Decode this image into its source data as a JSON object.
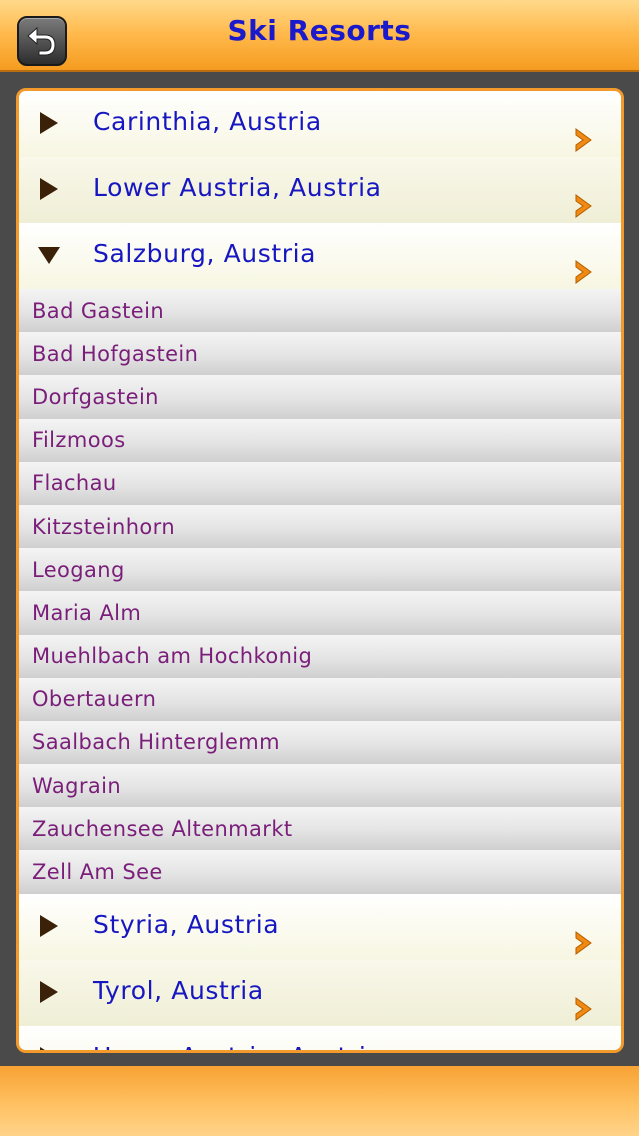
{
  "header": {
    "title": "Ski Resorts",
    "back_icon": "back-arrow-icon"
  },
  "colors": {
    "accent": "#f59c20",
    "title": "#1a1acc",
    "group_text": "#1717c2",
    "resort_text": "#7a1e7a"
  },
  "list": {
    "groups": [
      {
        "label": "Carinthia, Austria",
        "expanded": false
      },
      {
        "label": "Lower Austria, Austria",
        "expanded": false
      },
      {
        "label": "Salzburg, Austria",
        "expanded": true
      },
      {
        "label": "Styria, Austria",
        "expanded": false
      },
      {
        "label": "Tyrol, Austria",
        "expanded": false
      },
      {
        "label": "Upper Austria, Austria",
        "expanded": false
      }
    ],
    "resorts": [
      "Bad Gastein",
      "Bad Hofgastein",
      "Dorfgastein",
      "Filzmoos",
      "Flachau",
      "Kitzsteinhorn",
      "Leogang",
      "Maria Alm",
      "Muehlbach am Hochkonig",
      "Obertauern",
      "Saalbach Hinterglemm",
      "Wagrain",
      "Zauchensee Altenmarkt",
      "Zell Am See"
    ]
  }
}
